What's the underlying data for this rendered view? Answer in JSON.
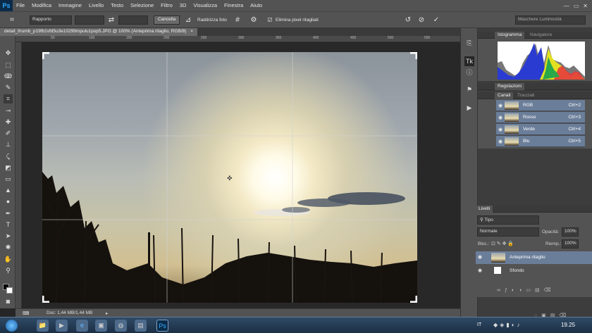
{
  "app": {
    "logo": "Ps"
  },
  "menu": [
    "File",
    "Modifica",
    "Immagine",
    "Livello",
    "Testo",
    "Selezione",
    "Filtro",
    "3D",
    "Visualizza",
    "Finestra",
    "Aiuto"
  ],
  "window_controls": {
    "minimize": "—",
    "maximize": "▭",
    "close": "✕"
  },
  "options": {
    "ratio_value": "Rapporto",
    "clear_label": "Cancella",
    "straighten_label": "Raddrizza foto",
    "delete_cropped_label": "Elimina pixel ritagliati",
    "delete_cropped_checked": true,
    "workspace_value": "Maschere Luminosità"
  },
  "document": {
    "tab_title": "detail_thumb_p19fb1vfd5u3e10299mpulu1psp5.JPG @ 100% (Anteprima ritaglio, RGB/8)",
    "close": "×"
  },
  "ruler_labels": [
    "50",
    "100",
    "150",
    "200",
    "250",
    "300",
    "350",
    "400",
    "450",
    "500",
    "550"
  ],
  "status": {
    "doc_info": "Doc: 1,44 MB/1,44 MB"
  },
  "panels": {
    "histogram_tabs": [
      "Istogramma",
      "Navigatore"
    ],
    "adjustments_tab": "Regolazioni",
    "channels_tabs": [
      "Canali",
      "Tracciati"
    ],
    "channels": [
      {
        "name": "RGB",
        "shortcut": "Ctrl+2"
      },
      {
        "name": "Rosso",
        "shortcut": "Ctrl+3"
      },
      {
        "name": "Verde",
        "shortcut": "Ctrl+4"
      },
      {
        "name": "Blu",
        "shortcut": "Ctrl+5"
      }
    ],
    "layers_tab": "Livelli",
    "layers_filter": "Tipo",
    "blend_mode": "Normale",
    "opacity_label": "Opacità:",
    "opacity_value": "100%",
    "lock_label": "Bloc.:",
    "fill_label": "Riemp.:",
    "fill_value": "100%",
    "layers": [
      {
        "name": "Anteprima ritaglio",
        "selected": true
      },
      {
        "name": "Sfondo",
        "selected": false
      }
    ]
  },
  "taskbar": {
    "lang": "IT",
    "time": "19.25"
  },
  "colors": {
    "accent": "#6b7e99",
    "panel": "#535353",
    "canvas": "#282828"
  }
}
